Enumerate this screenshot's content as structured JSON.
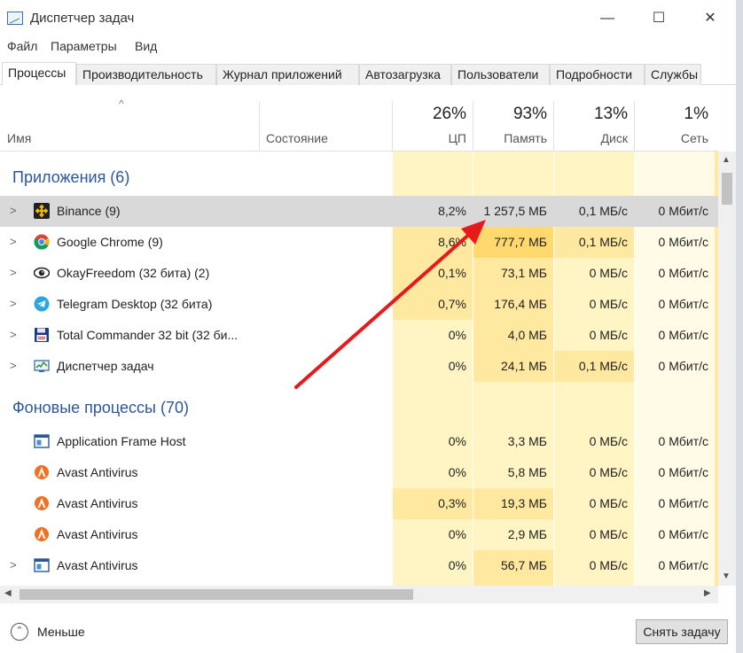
{
  "window": {
    "title": "Диспетчер задач",
    "minimize": "—",
    "maximize": "☐",
    "close": "✕"
  },
  "menu": [
    "Файл",
    "Параметры",
    "Вид"
  ],
  "tabs": [
    "Процессы",
    "Производительность",
    "Журнал приложений",
    "Автозагрузка",
    "Пользователи",
    "Подробности",
    "Службы"
  ],
  "active_tab": "Процессы",
  "columns": {
    "name": "Имя",
    "status": "Состояние",
    "cpu": {
      "pct": "26%",
      "label": "ЦП"
    },
    "memory": {
      "pct": "93%",
      "label": "Память"
    },
    "disk": {
      "pct": "13%",
      "label": "Диск"
    },
    "network": {
      "pct": "1%",
      "label": "Сеть"
    }
  },
  "groups": {
    "apps": {
      "title": "Приложения (6)",
      "rows": [
        {
          "name": "Binance (9)",
          "icon": "binance-icon",
          "expandable": true,
          "cpu": "8,2%",
          "mem": "1 257,5 МБ",
          "disk": "0,1 МБ/с",
          "net": "0 Мбит/с",
          "selected": true
        },
        {
          "name": "Google Chrome (9)",
          "icon": "chrome-icon",
          "expandable": true,
          "cpu": "8,6%",
          "mem": "777,7 МБ",
          "disk": "0,1 МБ/с",
          "net": "0 Мбит/с"
        },
        {
          "name": "OkayFreedom (32 бита) (2)",
          "icon": "eye-icon",
          "expandable": true,
          "cpu": "0,1%",
          "mem": "73,1 МБ",
          "disk": "0 МБ/с",
          "net": "0 Мбит/с"
        },
        {
          "name": "Telegram Desktop (32 бита)",
          "icon": "telegram-icon",
          "expandable": true,
          "cpu": "0,7%",
          "mem": "176,4 МБ",
          "disk": "0 МБ/с",
          "net": "0 Мбит/с"
        },
        {
          "name": "Total Commander 32 bit (32 би...",
          "icon": "floppy-icon",
          "expandable": true,
          "cpu": "0%",
          "mem": "4,0 МБ",
          "disk": "0 МБ/с",
          "net": "0 Мбит/с"
        },
        {
          "name": "Диспетчер задач",
          "icon": "task-manager-icon",
          "expandable": true,
          "cpu": "0%",
          "mem": "24,1 МБ",
          "disk": "0,1 МБ/с",
          "net": "0 Мбит/с"
        }
      ]
    },
    "background": {
      "title": "Фоновые процессы (70)",
      "rows": [
        {
          "name": "Application Frame Host",
          "icon": "window-icon",
          "expandable": false,
          "cpu": "0%",
          "mem": "3,3 МБ",
          "disk": "0 МБ/с",
          "net": "0 Мбит/с"
        },
        {
          "name": "Avast Antivirus",
          "icon": "avast-icon",
          "expandable": false,
          "cpu": "0%",
          "mem": "5,8 МБ",
          "disk": "0 МБ/с",
          "net": "0 Мбит/с"
        },
        {
          "name": "Avast Antivirus",
          "icon": "avast-icon",
          "expandable": false,
          "cpu": "0,3%",
          "mem": "19,3 МБ",
          "disk": "0 МБ/с",
          "net": "0 Мбит/с"
        },
        {
          "name": "Avast Antivirus",
          "icon": "avast-icon",
          "expandable": false,
          "cpu": "0%",
          "mem": "2,9 МБ",
          "disk": "0 МБ/с",
          "net": "0 Мбит/с"
        },
        {
          "name": "Avast Antivirus",
          "icon": "window-icon",
          "expandable": true,
          "cpu": "0%",
          "mem": "56,7 МБ",
          "disk": "0 МБ/с",
          "net": "0 Мбит/с"
        }
      ]
    }
  },
  "footer": {
    "less_label": "Меньше",
    "end_task": "Снять задачу"
  },
  "colors": {
    "group_title": "#2b5797",
    "heat_light": "#fff4c4",
    "heat_medium": "#ffe8a0",
    "selected_row": "#d9d9d9",
    "annotation_arrow": "#e8191a"
  }
}
